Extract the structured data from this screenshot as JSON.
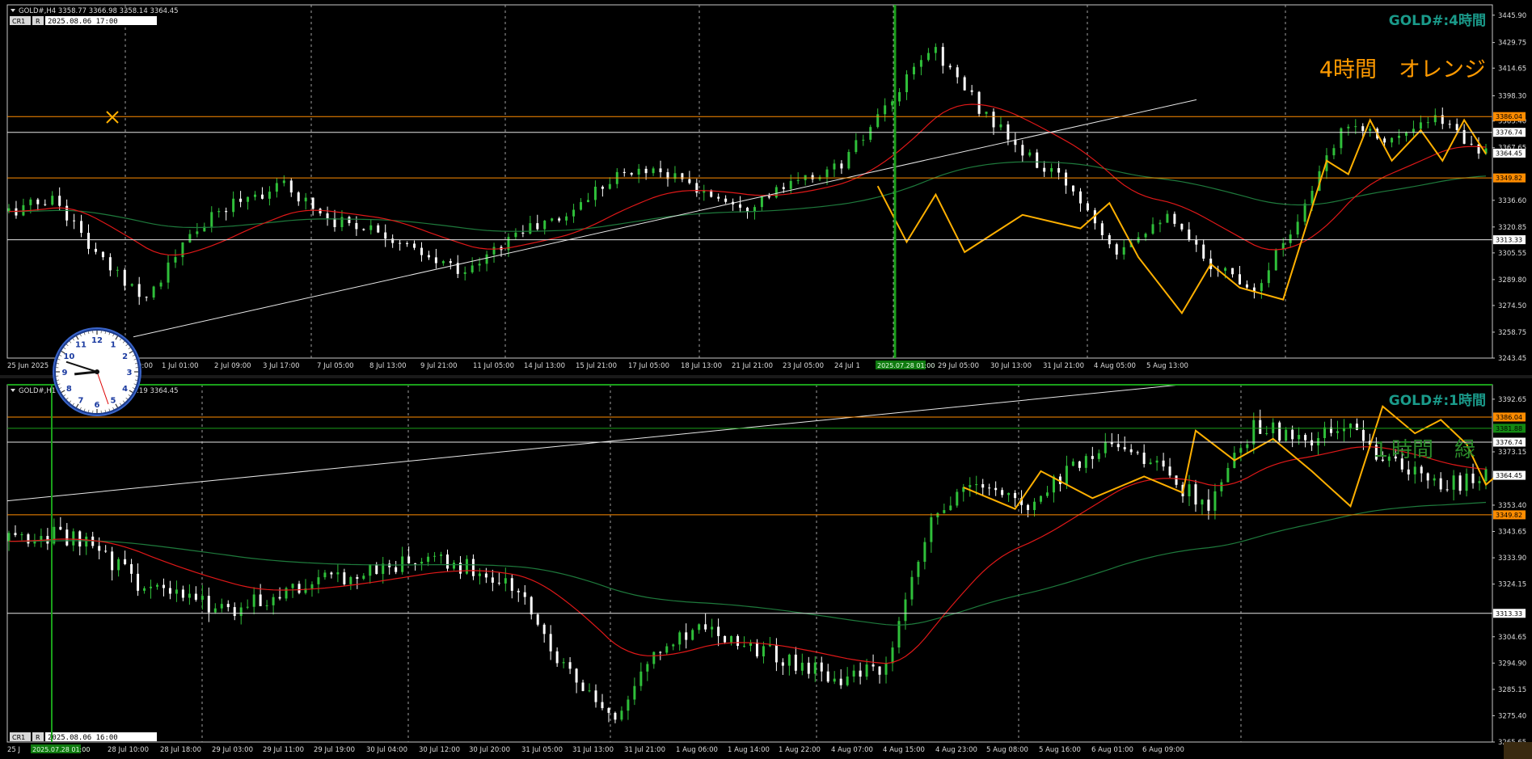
{
  "colors": {
    "background": "#000000",
    "frame": "#c8c8c8",
    "grid": "#a0a0a0",
    "candle": "#2fbf3a",
    "candle_down": "#ffffff",
    "ma_red": "#e01818",
    "ma_green": "#1e7a3c",
    "zigzag": "#ffb000",
    "orange_line": "#ff8c00",
    "label_green": "#2a8a2a",
    "label_teal": "#1a9a8a",
    "label_orange": "#ff9a00",
    "separator_green": "#1aa01a"
  },
  "panel_h4": {
    "info": "GOLD#,H4  3358.77 3366.98 3358.14 3364.45",
    "btn1": "CR1",
    "btn2": "R",
    "date_box": "2025.08.06 17:00",
    "corner_title": "GOLD#:4時間",
    "big_label": "4時間　オレンジ",
    "x_labels": [
      "25 Jun 2025",
      "27 Jun 09:00",
      "1 Jul 01:00",
      "2 Jul 09:00",
      "3 Jul 17:00",
      "7 Jul 05:00",
      "8 Jul 13:00",
      "9 Jul 21:00",
      "11 Jul 05:00",
      "14 Jul 13:00",
      "15 Jul 21:00",
      "17 Jul 05:00",
      "18 Jul 13:00",
      "21 Jul 21:00",
      "23 Jul 05:00",
      "24 Jul 1",
      "2025.07.28 01:00",
      "29 Jul 05:00",
      "30 Jul 13:00",
      "31 Jul 21:00",
      "4 Aug 05:00",
      "5 Aug 13:00"
    ],
    "y_labels": [
      "3445.90",
      "3429.75",
      "3414.65",
      "3398.30",
      "3383.40",
      "3367.65",
      "3336.60",
      "3320.85",
      "3305.55",
      "3289.80",
      "3274.50",
      "3258.75",
      "3243.45"
    ],
    "price_tags": [
      {
        "value": "3386.04",
        "kind": "orange"
      },
      {
        "value": "3376.74",
        "kind": "white"
      },
      {
        "value": "3364.45",
        "kind": "white"
      },
      {
        "value": "3349.82",
        "kind": "orange"
      },
      {
        "value": "3313.33",
        "kind": "white"
      }
    ]
  },
  "panel_h1": {
    "info": "GOLD#,H1  3358.77 3366.98 3358.19 3364.45",
    "btn1": "CR1",
    "btn2": "R",
    "date_box": "2025.08.06 16:00",
    "corner_title": "GOLD#:1時間",
    "big_label": "１時間　緑",
    "x_labels": [
      "25 J",
      "2025.07.28 01:00",
      "28 Jul 10:00",
      "28 Jul 18:00",
      "29 Jul 03:00",
      "29 Jul 11:00",
      "29 Jul 19:00",
      "30 Jul 04:00",
      "30 Jul 12:00",
      "30 Jul 20:00",
      "31 Jul 05:00",
      "31 Jul 13:00",
      "31 Jul 21:00",
      "1 Aug 06:00",
      "1 Aug 14:00",
      "1 Aug 22:00",
      "4 Aug 07:00",
      "4 Aug 15:00",
      "4 Aug 23:00",
      "5 Aug 08:00",
      "5 Aug 16:00",
      "6 Aug 01:00",
      "6 Aug 09:00"
    ],
    "y_labels": [
      "3392.65",
      "3373.15",
      "3353.40",
      "3343.65",
      "3333.90",
      "3324.15",
      "3304.65",
      "3294.90",
      "3285.15",
      "3275.40",
      "3265.65"
    ],
    "price_tags": [
      {
        "value": "3386.04",
        "kind": "orange"
      },
      {
        "value": "3381.88",
        "kind": "green"
      },
      {
        "value": "3376.74",
        "kind": "white"
      },
      {
        "value": "3364.45",
        "kind": "white"
      },
      {
        "value": "3349.82",
        "kind": "orange"
      },
      {
        "value": "3313.33",
        "kind": "white"
      }
    ]
  },
  "clock": {
    "time": "8:48"
  },
  "chart_data": [
    {
      "type": "candlestick",
      "title": "GOLD#:4時間",
      "timeframe": "H4",
      "ylim": [
        3243.45,
        3452.0
      ],
      "categories": [
        "25 Jun 2025",
        "27 Jun 09:00",
        "1 Jul 01:00",
        "2 Jul 09:00",
        "3 Jul 17:00",
        "7 Jul 05:00",
        "8 Jul 13:00",
        "9 Jul 21:00",
        "11 Jul 05:00",
        "14 Jul 13:00",
        "15 Jul 21:00",
        "17 Jul 05:00",
        "18 Jul 13:00",
        "21 Jul 21:00",
        "23 Jul 05:00",
        "24 Jul 1",
        "2025.07.28 01:00",
        "29 Jul 05:00",
        "30 Jul 13:00",
        "31 Jul 21:00",
        "4 Aug 05:00",
        "5 Aug 13:00"
      ],
      "close": [
        3330,
        3290,
        3318,
        3342,
        3330,
        3326,
        3302,
        3320,
        3345,
        3352,
        3340,
        3334,
        3355,
        3392,
        3425,
        3362,
        3310,
        3325,
        3278,
        3362,
        3378,
        3364.45
      ],
      "horizontal_levels": [
        3386.04,
        3376.74,
        3349.82,
        3313.33
      ],
      "grid": true
    },
    {
      "type": "candlestick",
      "title": "GOLD#:1時間",
      "timeframe": "H1",
      "ylim": [
        3265.65,
        3398.0
      ],
      "categories": [
        "25 J",
        "2025.07.28 01:00",
        "28 Jul 10:00",
        "28 Jul 18:00",
        "29 Jul 03:00",
        "29 Jul 11:00",
        "29 Jul 19:00",
        "30 Jul 04:00",
        "30 Jul 12:00",
        "30 Jul 20:00",
        "31 Jul 05:00",
        "31 Jul 13:00",
        "31 Jul 21:00",
        "1 Aug 06:00",
        "1 Aug 14:00",
        "1 Aug 22:00",
        "4 Aug 07:00",
        "4 Aug 15:00",
        "4 Aug 23:00",
        "5 Aug 08:00",
        "5 Aug 16:00",
        "6 Aug 01:00",
        "6 Aug 09:00"
      ],
      "close": [
        3342,
        3340,
        3320,
        3316,
        3324,
        3327,
        3332,
        3334,
        3322,
        3272,
        3300,
        3305,
        3296,
        3292,
        3349,
        3363,
        3357,
        3381,
        3372,
        3352,
        3385,
        3376,
        3364.45
      ],
      "horizontal_levels": [
        3386.04,
        3381.88,
        3376.74,
        3349.82,
        3313.33
      ],
      "grid": true
    }
  ]
}
